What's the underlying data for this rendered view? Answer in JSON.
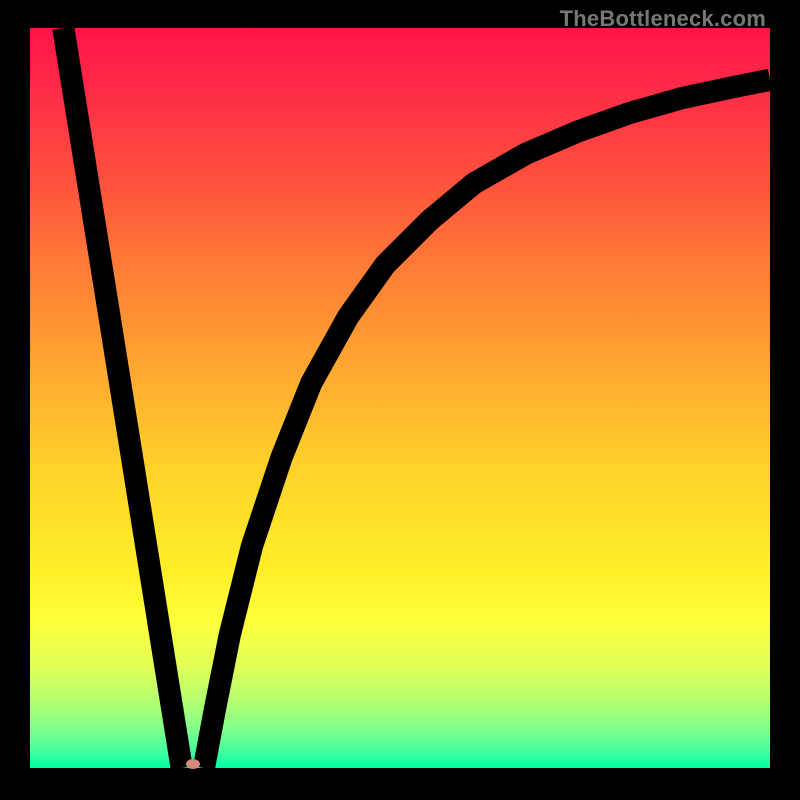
{
  "watermark": "TheBottleneck.com",
  "colors": {
    "frame": "#000000",
    "gradient_top": "#ff1448",
    "gradient_bottom": "#00ffa4",
    "curve": "#000000",
    "marker": "#d28b7a"
  },
  "chart_data": {
    "type": "line",
    "title": "",
    "xlabel": "",
    "ylabel": "",
    "xlim": [
      0,
      100
    ],
    "ylim": [
      0,
      100
    ],
    "series": [
      {
        "name": "left-line",
        "x": [
          4.5,
          20.5
        ],
        "y": [
          100,
          0
        ]
      },
      {
        "name": "right-curve",
        "x": [
          23.5,
          25,
          27,
          30,
          34,
          38,
          43,
          48,
          54,
          60,
          67,
          74,
          81,
          88,
          95,
          100
        ],
        "y": [
          0,
          8,
          18,
          30,
          42,
          52,
          61,
          68,
          74,
          79,
          83,
          86,
          88.5,
          90.5,
          92,
          93
        ]
      }
    ],
    "marker": {
      "x": 22,
      "y": 0.5
    },
    "legend": false,
    "grid": false
  }
}
